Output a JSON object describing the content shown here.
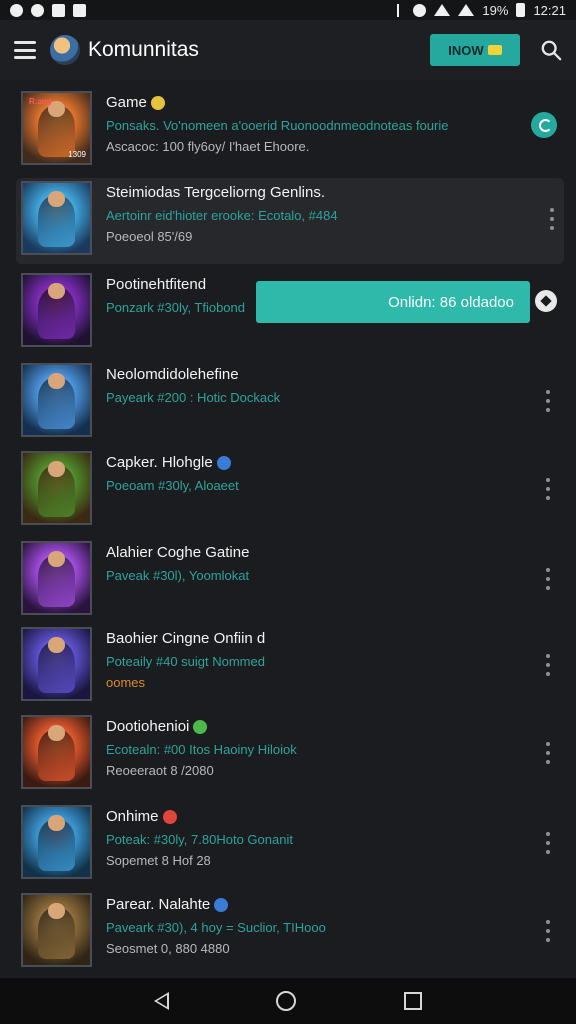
{
  "status_bar": {
    "battery": "19%",
    "time": "12:21",
    "left_icons": [
      "notification-icon",
      "notification-icon",
      "photo-icon",
      "app-icon"
    ],
    "right_icons": [
      "bluetooth-icon",
      "alarm-icon",
      "wifi-icon",
      "signal-icon",
      "battery-icon"
    ]
  },
  "app_bar": {
    "title": "Komunnitas",
    "button_label": "INOW",
    "accent": "#25a99e"
  },
  "toast": {
    "text": "Onlidn: 86 oldadoo",
    "color": "#2fb9aa"
  },
  "games": [
    {
      "title": "Game",
      "line1": "Ponsaks. Vo'nomeen a'ooerid Ruonoodnmeodnoteas fourie",
      "line2": "Ascacoc: 100 fly6oy/ I'haet Ehoore.",
      "thumb_label": "R:ang",
      "thumb_tag": "1309",
      "colors": [
        "#3f2b1e",
        "#d96f2b",
        "#f2b84b"
      ]
    },
    {
      "title": "Steimiodas Tergceliorng Genlins.",
      "line1": "Aertoinr eid'hioter erooke: Ecotalo, #484",
      "line2": "Poeoeol 85'/69",
      "colors": [
        "#1a3a5e",
        "#3fa3d8",
        "#f2c14e"
      ]
    },
    {
      "title": "Pootinehtfitend",
      "line1": "Ponzark #30ly, Tfiobond",
      "colors": [
        "#1e1230",
        "#7a2bb5",
        "#c23a3a"
      ]
    },
    {
      "title": "Neolomdidolehefine",
      "line1": "Payeark #200 : Hotic Dockack",
      "colors": [
        "#15304f",
        "#4a90d6",
        "#a6d1f0"
      ]
    },
    {
      "title": "Capker. Hlohgle",
      "line1": "Poeoam #30ly, Aloaeet",
      "colors": [
        "#3a2a12",
        "#4f8a2a",
        "#e0a03a"
      ]
    },
    {
      "title": "Alahier Coghe Gatine",
      "line1": "Paveak #30l), Yoomlokat",
      "colors": [
        "#2a143f",
        "#9b4ad6",
        "#e08ad6"
      ]
    },
    {
      "title": "Baohier Cingne Onfiin d",
      "line1": "Poteaily #40 suigt Nommed",
      "line2": "oomes",
      "line2_orange": true,
      "colors": [
        "#1a1640",
        "#5b4fc8",
        "#b59af0"
      ]
    },
    {
      "title": "Dootiohenioi",
      "line1": "Ecotealn: #00 Itos Haoiny Hiloiok",
      "line2": "Reoeeraot 8 /2080",
      "colors": [
        "#3a1a12",
        "#d8542b",
        "#f0b24a"
      ]
    },
    {
      "title": "Onhime",
      "line1": "Poteak: #30ly, 7.80Hoto Gonanit",
      "line2": "Sopemet 8 Hof 28",
      "colors": [
        "#12324a",
        "#3a94cf",
        "#d85a3a"
      ]
    },
    {
      "title": "Parear. Nalahte",
      "line1": "Paveark #30), 4 hoy = Suclior, TIHooo",
      "line2": "Seosmet 0, 880 4880",
      "colors": [
        "#2f2516",
        "#8a6a3a",
        "#e2c48a"
      ]
    }
  ]
}
